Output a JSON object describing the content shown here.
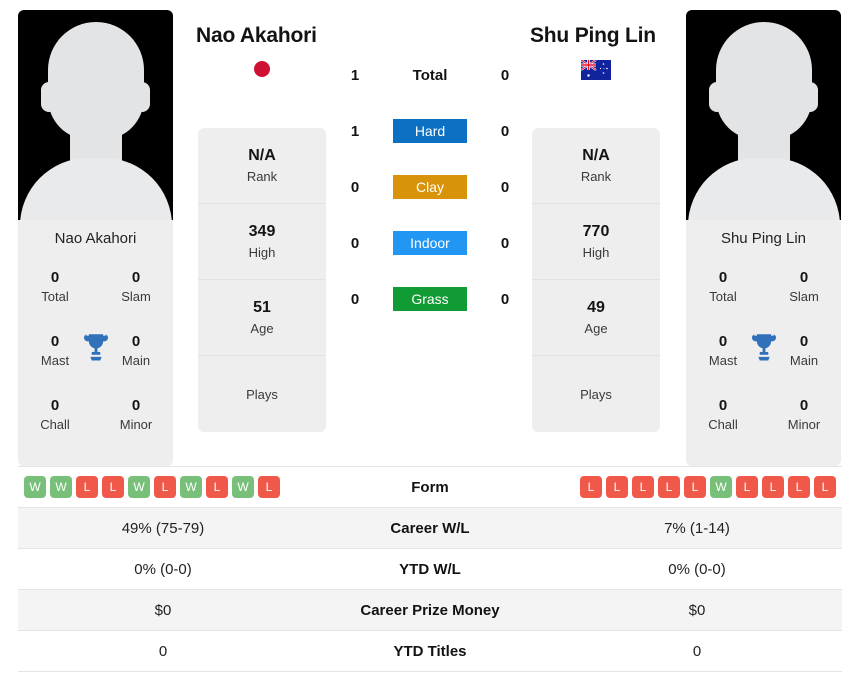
{
  "players": {
    "left": {
      "name": "Nao Akahori",
      "photo_caption": "Nao Akahori",
      "country_flag": "japan-flag",
      "titles": {
        "total": "0",
        "total_label": "Total",
        "slam": "0",
        "slam_label": "Slam",
        "mast": "0",
        "mast_label": "Mast",
        "main": "0",
        "main_label": "Main",
        "chall": "0",
        "chall_label": "Chall",
        "minor": "0",
        "minor_label": "Minor"
      },
      "stats": [
        {
          "value": "N/A",
          "label": "Rank"
        },
        {
          "value": "349",
          "label": "High"
        },
        {
          "value": "51",
          "label": "Age"
        },
        {
          "value": "",
          "label": "Plays"
        }
      ],
      "form": [
        "W",
        "W",
        "L",
        "L",
        "W",
        "L",
        "W",
        "L",
        "W",
        "L"
      ],
      "career_wl": "49% (75-79)",
      "ytd_wl": "0% (0-0)",
      "career_prize_money": "$0",
      "ytd_titles": "0"
    },
    "right": {
      "name": "Shu Ping Lin",
      "photo_caption": "Shu Ping Lin",
      "country_flag": "australia-flag",
      "titles": {
        "total": "0",
        "total_label": "Total",
        "slam": "0",
        "slam_label": "Slam",
        "mast": "0",
        "mast_label": "Mast",
        "main": "0",
        "main_label": "Main",
        "chall": "0",
        "chall_label": "Chall",
        "minor": "0",
        "minor_label": "Minor"
      },
      "stats": [
        {
          "value": "N/A",
          "label": "Rank"
        },
        {
          "value": "770",
          "label": "High"
        },
        {
          "value": "49",
          "label": "Age"
        },
        {
          "value": "",
          "label": "Plays"
        }
      ],
      "form": [
        "L",
        "L",
        "L",
        "L",
        "L",
        "W",
        "L",
        "L",
        "L",
        "L"
      ],
      "career_wl": "7% (1-14)",
      "ytd_wl": "0% (0-0)",
      "career_prize_money": "$0",
      "ytd_titles": "0"
    }
  },
  "head_to_head": [
    {
      "label": "Total",
      "left": "1",
      "right": "0",
      "badge": false,
      "color": ""
    },
    {
      "label": "Hard",
      "left": "1",
      "right": "0",
      "badge": true,
      "color": "#0c71c3"
    },
    {
      "label": "Clay",
      "left": "0",
      "right": "0",
      "badge": true,
      "color": "#d9930a"
    },
    {
      "label": "Indoor",
      "left": "0",
      "right": "0",
      "badge": true,
      "color": "#2196f3"
    },
    {
      "label": "Grass",
      "left": "0",
      "right": "0",
      "badge": true,
      "color": "#119b34"
    }
  ],
  "comparison_rows": [
    {
      "label": "Form",
      "left": "",
      "right": ""
    },
    {
      "label": "Career W/L",
      "left": "49% (75-79)",
      "right": "7% (1-14)"
    },
    {
      "label": "YTD W/L",
      "left": "0% (0-0)",
      "right": "0% (0-0)"
    },
    {
      "label": "Career Prize Money",
      "left": "$0",
      "right": "$0"
    },
    {
      "label": "YTD Titles",
      "left": "0",
      "right": "0"
    }
  ],
  "colors": {
    "card_bg": "#eeeeee",
    "row_shade": "#f4f4f4",
    "win_badge": "#78c07a",
    "loss_badge": "#f0584a",
    "trophy": "#3071b9"
  }
}
